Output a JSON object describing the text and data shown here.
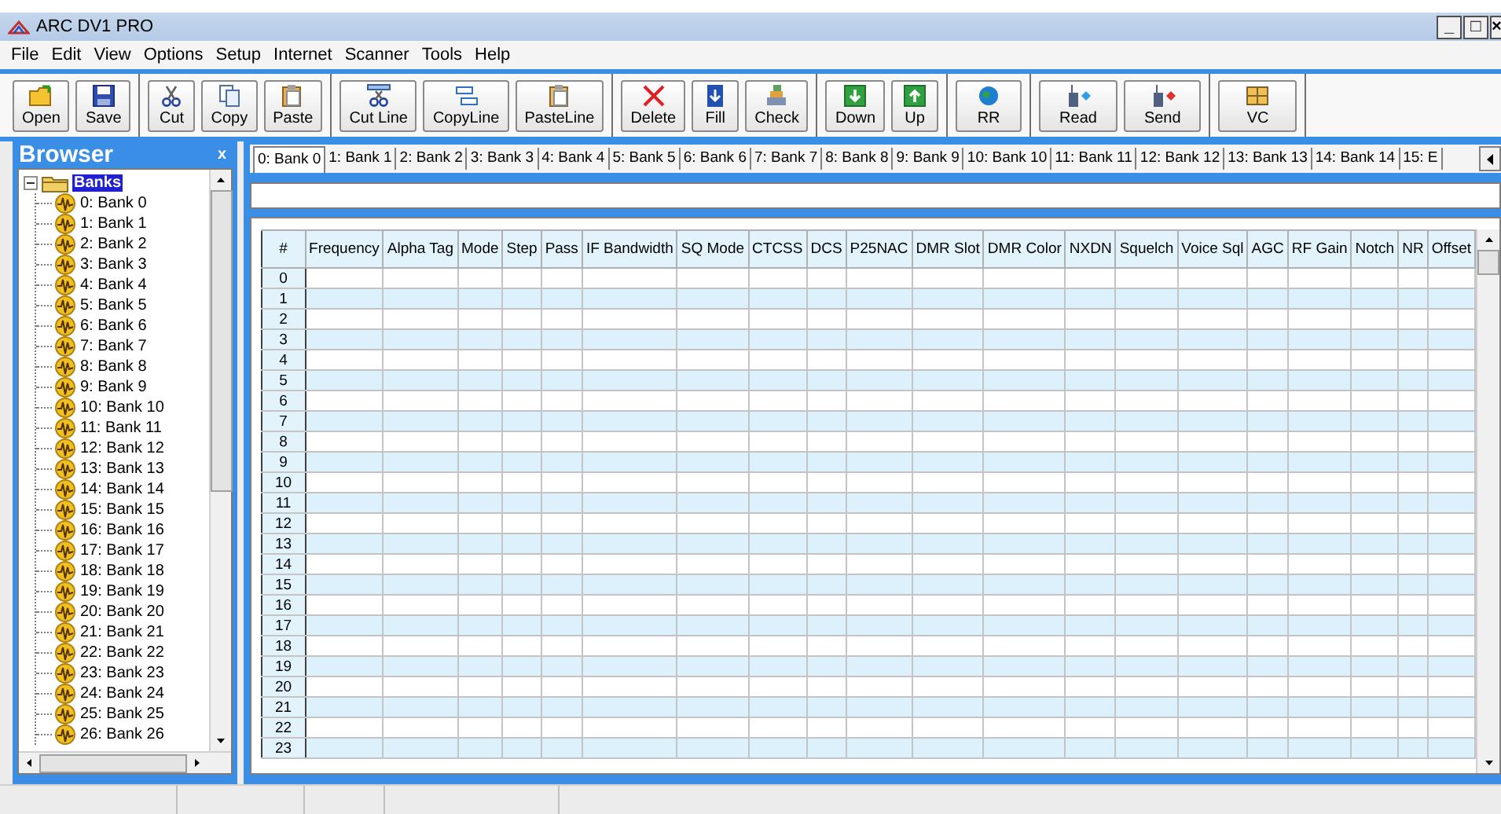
{
  "window": {
    "title": "ARC DV1 PRO",
    "controls": [
      "_",
      "□",
      "×"
    ]
  },
  "menu": [
    "File",
    "Edit",
    "View",
    "Options",
    "Setup",
    "Internet",
    "Scanner",
    "Tools",
    "Help"
  ],
  "toolbar": {
    "groups": [
      {
        "buttons": [
          "Open",
          "Save"
        ]
      },
      {
        "buttons": [
          "Cut",
          "Copy",
          "Paste"
        ]
      },
      {
        "buttons": [
          "Cut Line",
          "CopyLine",
          "PasteLine"
        ]
      },
      {
        "buttons": [
          "Delete",
          "Fill",
          "Check"
        ]
      },
      {
        "buttons": [
          "Down",
          "Up"
        ]
      },
      {
        "buttons": [
          "RR"
        ]
      },
      {
        "buttons": [
          "Read",
          "Send"
        ]
      },
      {
        "buttons": [
          "VC"
        ]
      }
    ]
  },
  "browser": {
    "title": "Browser",
    "close": "x",
    "tree": [
      {
        "label": "Banks",
        "selected": true,
        "expanded": true,
        "children": [
          {
            "label": "0: Bank 0",
            "selected": false
          },
          {
            "label": "1: Bank 1",
            "selected": false
          },
          {
            "label": "2: Bank 2",
            "selected": false
          },
          {
            "label": "3: Bank 3",
            "selected": false
          },
          {
            "label": "4: Bank 4",
            "selected": false
          },
          {
            "label": "5: Bank 5",
            "selected": false
          },
          {
            "label": "6: Bank 6",
            "selected": false
          },
          {
            "label": "7: Bank 7",
            "selected": false
          },
          {
            "label": "8: Bank 8",
            "selected": false
          },
          {
            "label": "9: Bank 9",
            "selected": false
          },
          {
            "label": "10: Bank 10",
            "selected": false
          },
          {
            "label": "11: Bank 11",
            "selected": false
          },
          {
            "label": "12: Bank 12",
            "selected": false
          },
          {
            "label": "13: Bank 13",
            "selected": false
          },
          {
            "label": "14: Bank 14",
            "selected": false
          },
          {
            "label": "15: Bank 15",
            "selected": false
          },
          {
            "label": "16: Bank 16",
            "selected": false
          },
          {
            "label": "17: Bank 17",
            "selected": false
          },
          {
            "label": "18: Bank 18",
            "selected": false
          },
          {
            "label": "19: Bank 19",
            "selected": false
          },
          {
            "label": "20: Bank 20",
            "selected": false
          },
          {
            "label": "21: Bank 21",
            "selected": false
          },
          {
            "label": "22: Bank 22",
            "selected": false
          },
          {
            "label": "23: Bank 23",
            "selected": false
          },
          {
            "label": "24: Bank 24",
            "selected": false
          },
          {
            "label": "25: Bank 25",
            "selected": false
          },
          {
            "label": "26: Bank 26",
            "selected": false
          }
        ]
      }
    ]
  },
  "tabs": [
    {
      "label": "0: Bank 0",
      "selected": true
    },
    {
      "label": "1: Bank 1",
      "selected": false
    },
    {
      "label": "2: Bank 2",
      "selected": false
    },
    {
      "label": "3: Bank 3",
      "selected": false
    },
    {
      "label": "4: Bank 4",
      "selected": false
    },
    {
      "label": "5: Bank 5",
      "selected": false
    },
    {
      "label": "6: Bank 6",
      "selected": false
    },
    {
      "label": "7: Bank 7",
      "selected": false
    },
    {
      "label": "8: Bank 8",
      "selected": false
    },
    {
      "label": "9: Bank 9",
      "selected": false
    },
    {
      "label": "10: Bank 10",
      "selected": false
    },
    {
      "label": "11: Bank 11",
      "selected": false
    },
    {
      "label": "12: Bank 12",
      "selected": false
    },
    {
      "label": "13: Bank 13",
      "selected": false
    },
    {
      "label": "14: Bank 14",
      "selected": false
    },
    {
      "label": "15: E",
      "selected": false
    }
  ],
  "table": {
    "columns": [
      "#",
      "Frequency",
      "Alpha Tag",
      "Mode",
      "Step",
      "Pass",
      "IF Bandwidth",
      "SQ Mode",
      "CTCSS",
      "DCS",
      "P25NAC",
      "DMR Slot",
      "DMR Color",
      "NXDN",
      "Squelch",
      "Voice Sql",
      "AGC",
      "RF Gain",
      "Notch",
      "NR",
      "Offset"
    ],
    "rows": [
      "0",
      "1",
      "2",
      "3",
      "4",
      "5",
      "6",
      "7",
      "8",
      "9",
      "10",
      "11",
      "12",
      "13",
      "14",
      "15",
      "16",
      "17",
      "18",
      "19",
      "20",
      "21",
      "22",
      "23"
    ]
  }
}
